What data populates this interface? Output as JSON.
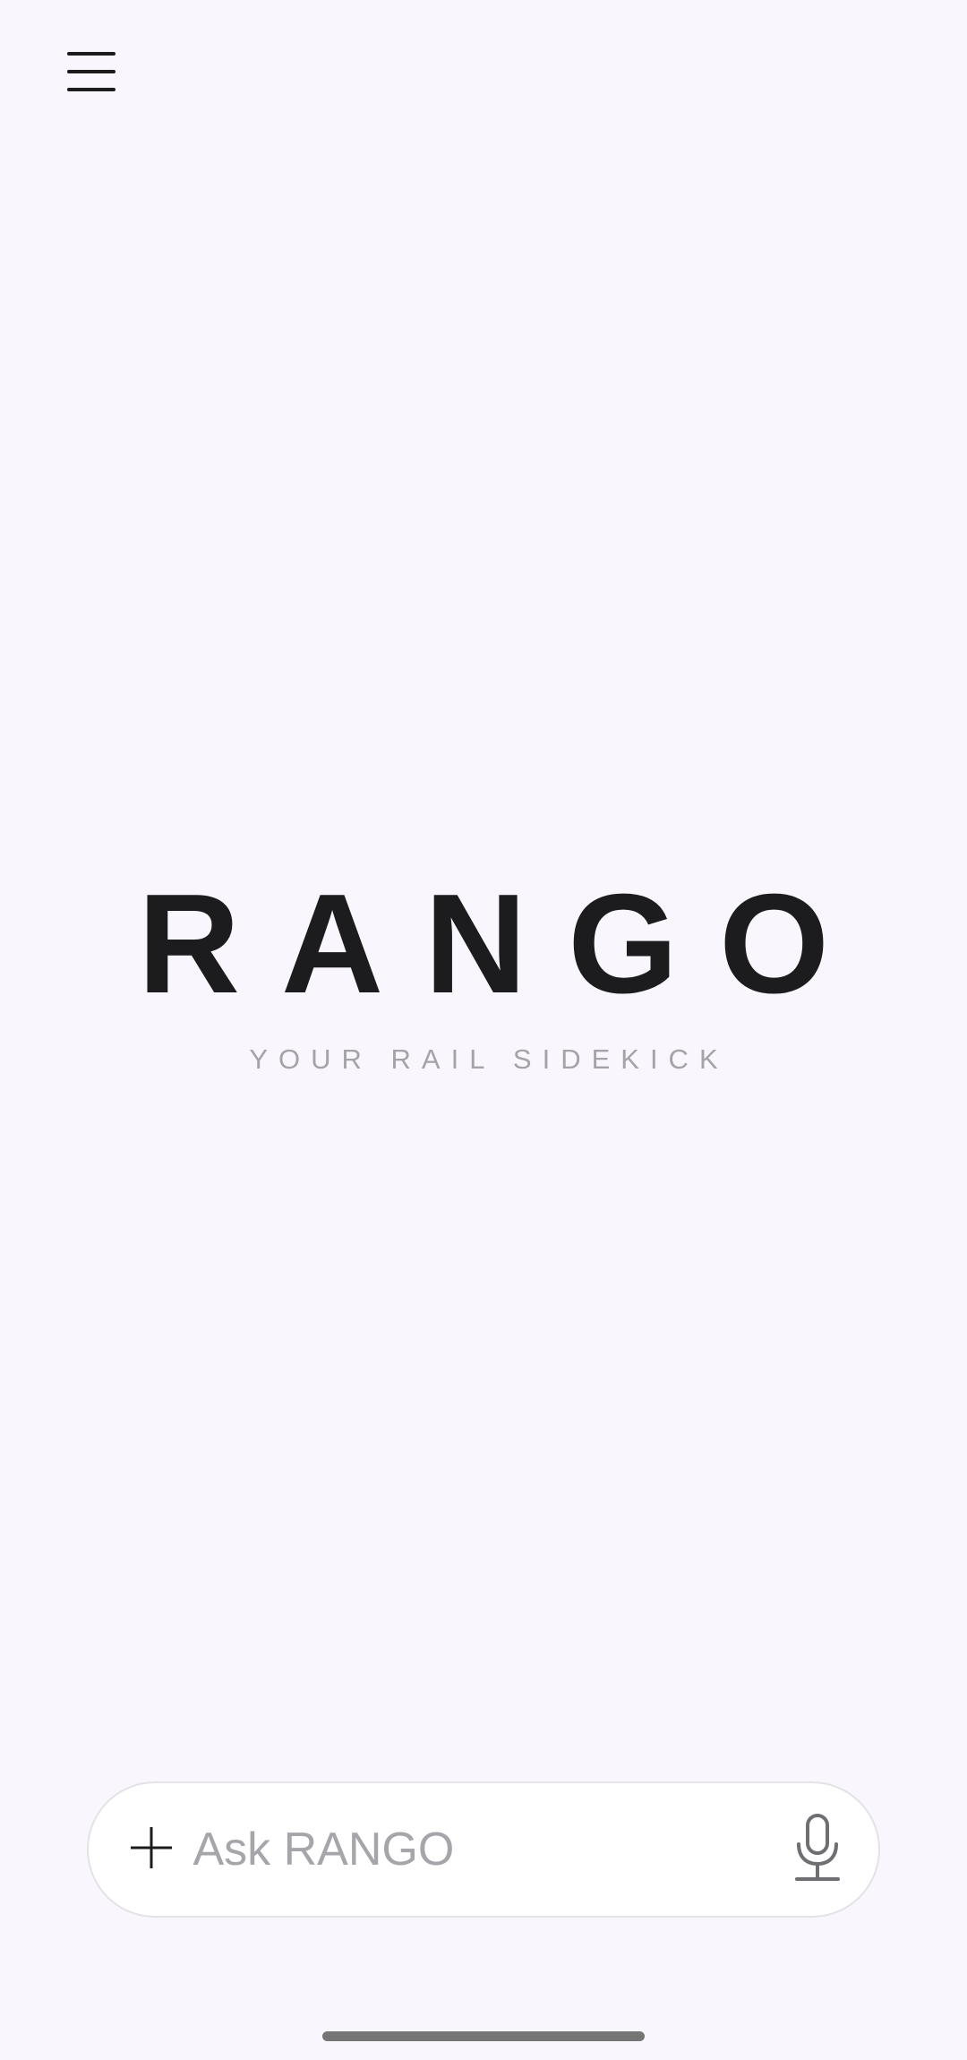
{
  "header": {
    "menu_icon": "hamburger-menu-icon"
  },
  "brand": {
    "title": "RANGO",
    "tagline": "YOUR RAIL SIDEKICK"
  },
  "composer": {
    "add_icon": "plus-icon",
    "placeholder": "Ask RANGO",
    "value": "",
    "mic_icon": "microphone-icon"
  },
  "colors": {
    "background": "#f9f7fd",
    "title": "#1c1c1e",
    "tagline": "#a3a3a8",
    "input_border": "#e3e2e6",
    "placeholder": "#a6a6aa"
  }
}
